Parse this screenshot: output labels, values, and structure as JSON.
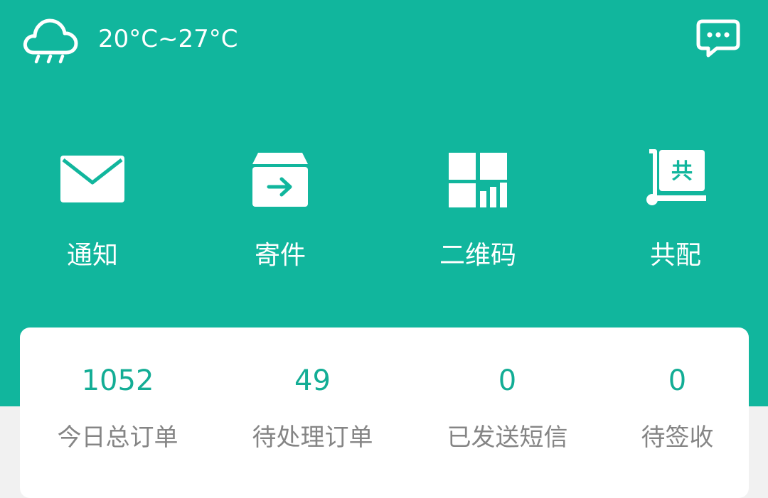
{
  "header": {
    "weather": {
      "icon": "cloud-rain-icon",
      "temperature": "20°C~27°C"
    },
    "message_icon": "chat-bubble-icon"
  },
  "functions": [
    {
      "label": "通知",
      "icon": "envelope-icon"
    },
    {
      "label": "寄件",
      "icon": "box-arrow-icon"
    },
    {
      "label": "二维码",
      "icon": "qr-code-icon"
    },
    {
      "label": "共配",
      "icon": "cart-share-icon"
    }
  ],
  "stats": [
    {
      "value": "1052",
      "label": "今日总订单"
    },
    {
      "value": "49",
      "label": "待处理订单"
    },
    {
      "value": "0",
      "label": "已发送短信"
    },
    {
      "value": "0",
      "label": "待签收"
    }
  ],
  "icon_glyph": "共",
  "colors": {
    "primary": "#11b69d",
    "stat_value": "#13ad95",
    "label_gray": "#858585",
    "page_bg": "#f1f1f1"
  }
}
